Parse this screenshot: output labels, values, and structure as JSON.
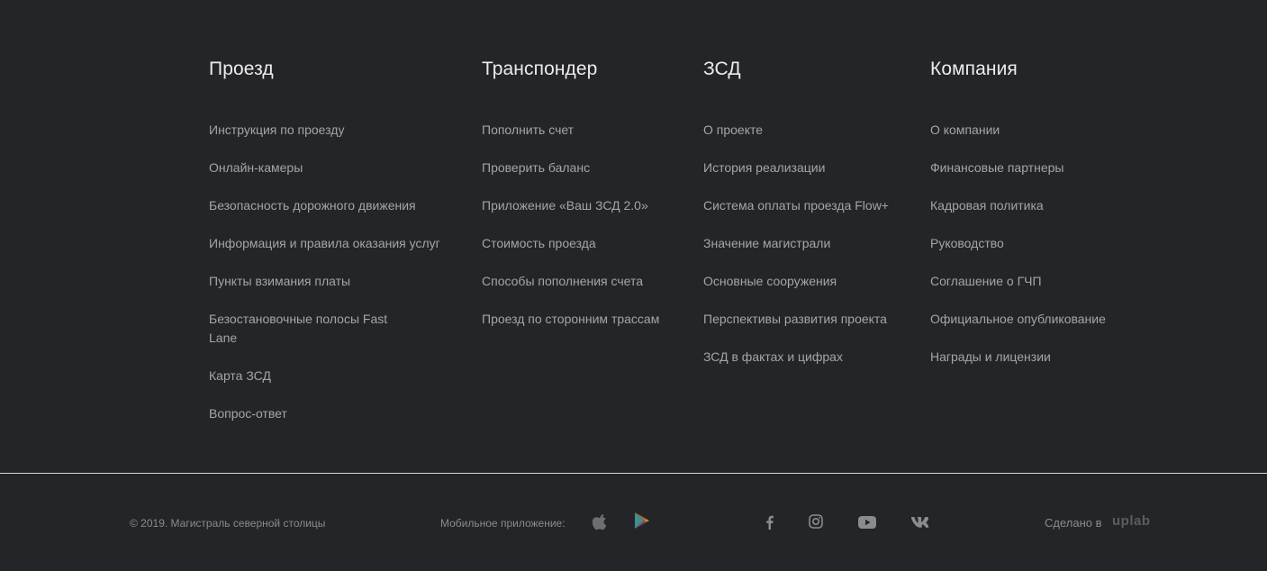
{
  "columns": [
    {
      "title": "Проезд",
      "items": [
        "Инструкция по проезду",
        "Онлайн-камеры",
        "Безопасность дорожного движения",
        "Информация и правила оказания услуг",
        "Пункты взимания платы",
        "Безостановочные полосы Fast Lane",
        "Карта ЗСД",
        "Вопрос-ответ"
      ]
    },
    {
      "title": "Транспондер",
      "items": [
        "Пополнить счет",
        "Проверить баланс",
        "Приложение «Ваш ЗСД 2.0»",
        "Стоимость проезда",
        "Способы пополнения счета",
        "Проезд по сторонним трассам"
      ]
    },
    {
      "title": "ЗСД",
      "items": [
        "О проекте",
        "История реализации",
        "Система оплаты проезда Flow+",
        "Значение магистрали",
        "Основные сооружения",
        "Перспективы развития проекта",
        "ЗСД в фактах и цифрах"
      ]
    },
    {
      "title": "Компания",
      "items": [
        "О компании",
        "Финансовые партнеры",
        "Кадровая политика",
        "Руководство",
        "Соглашение о ГЧП",
        "Официальное опубликование",
        "Награды и лицензии"
      ]
    }
  ],
  "footer": {
    "copyright": "© 2019. Магистраль северной столицы",
    "mobile_label": "Мобильное приложение:",
    "app_icons": [
      "apple-icon",
      "google-play-icon"
    ],
    "social_icons": [
      "facebook-icon",
      "instagram-icon",
      "youtube-icon",
      "vk-icon"
    ],
    "made_by_label": "Сделано в",
    "made_by_brand": "uplab"
  },
  "colors": {
    "background": "#242529",
    "heading": "#ececed",
    "link": "#a4a5a9",
    "muted": "#8a8b8f"
  }
}
